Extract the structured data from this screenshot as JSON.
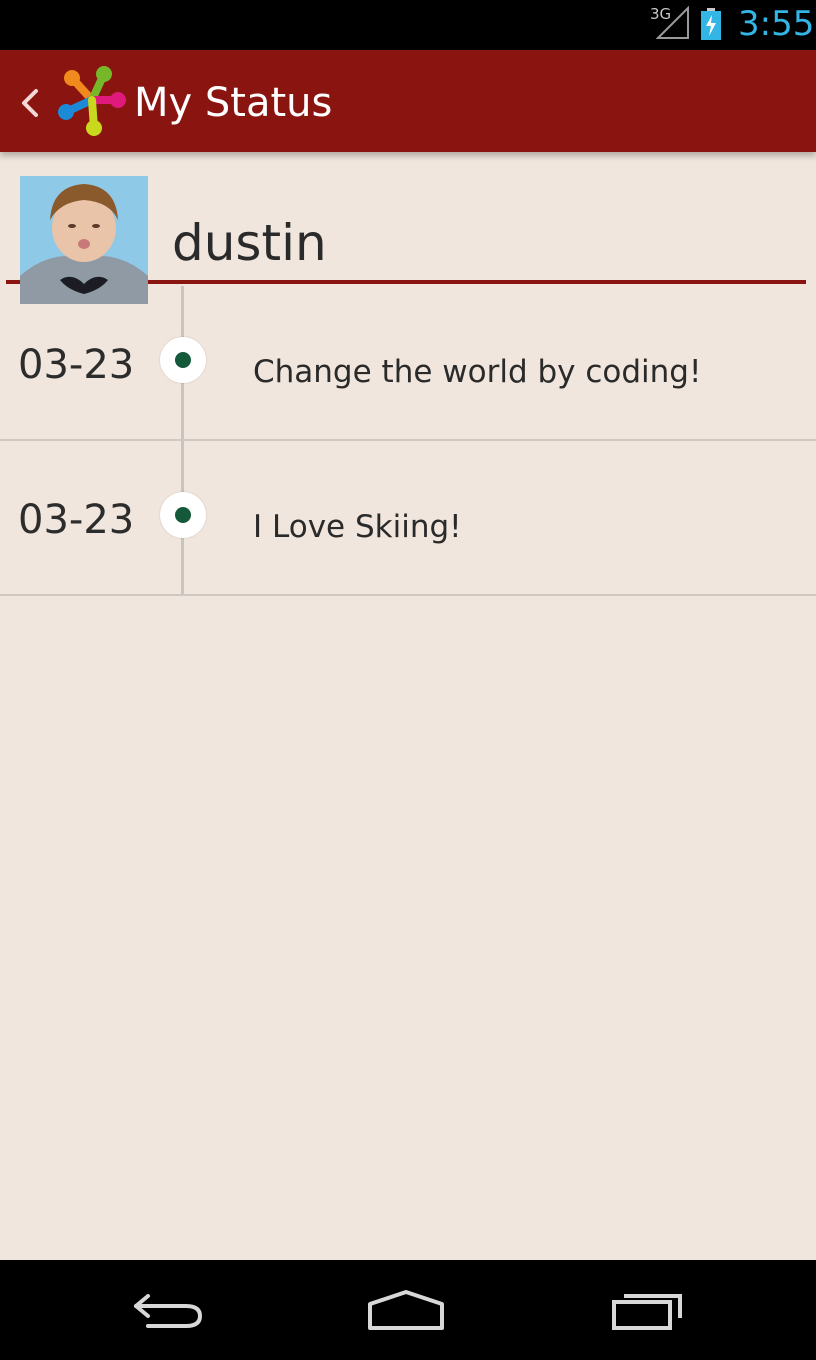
{
  "status_bar": {
    "network": "3G",
    "time": "3:55"
  },
  "action_bar": {
    "title": "My Status",
    "back_icon": "chevron-left-icon",
    "logo_icon": "app-logo-icon"
  },
  "profile": {
    "username": "dustin",
    "avatar": "avatar-photo"
  },
  "timeline": {
    "items": [
      {
        "date": "03-23",
        "text": "Change the world by coding!"
      },
      {
        "date": "03-23",
        "text": "I Love Skiing!"
      }
    ]
  },
  "nav_bar": {
    "back": "back-icon",
    "home": "home-icon",
    "recents": "recents-icon"
  },
  "colors": {
    "action_bar": "#8a140f",
    "background": "#f0e6dd",
    "accent_time": "#33b5e5",
    "timeline_dot": "#145a3a"
  }
}
